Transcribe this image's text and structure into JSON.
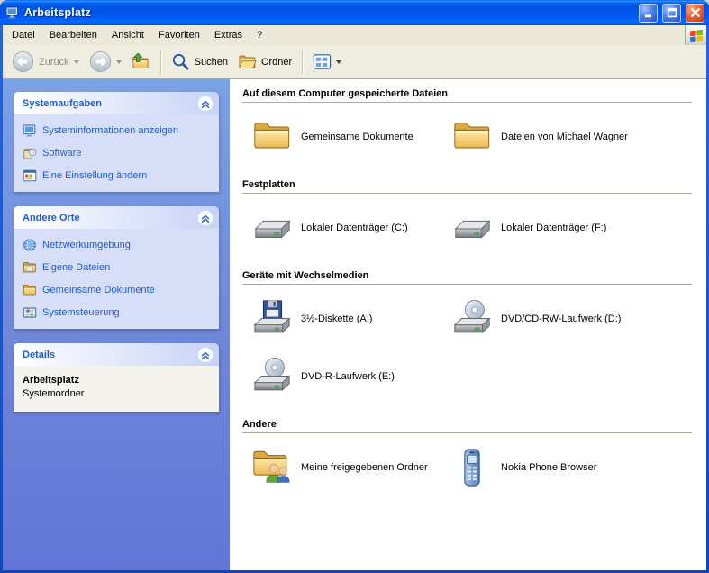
{
  "colors": {
    "titlebar_blue": "#0054E3",
    "taskpane_background": "#6E86D8",
    "taskpane_link": "#215DC6",
    "window_chrome": "#ECE9D8",
    "folder_yellow": "#EDB953",
    "close_button_red": "#C33B17"
  },
  "window": {
    "title": "Arbeitsplatz"
  },
  "menu": {
    "items": [
      "Datei",
      "Bearbeiten",
      "Ansicht",
      "Favoriten",
      "Extras",
      "?"
    ]
  },
  "toolbar": {
    "back": "Zurück",
    "search": "Suchen",
    "folders": "Ordner"
  },
  "sidebar": {
    "system_tasks": {
      "title": "Systemaufgaben",
      "items": [
        {
          "label": "Systeminformationen anzeigen",
          "icon": "system-information-icon"
        },
        {
          "label": "Software",
          "icon": "software-icon"
        },
        {
          "label": "Eine Einstellung ändern",
          "icon": "change-setting-icon"
        }
      ]
    },
    "other_places": {
      "title": "Andere Orte",
      "items": [
        {
          "label": "Netzwerkumgebung",
          "icon": "network-icon"
        },
        {
          "label": "Eigene Dateien",
          "icon": "my-documents-icon"
        },
        {
          "label": "Gemeinsame Dokumente",
          "icon": "shared-documents-icon"
        },
        {
          "label": "Systemsteuerung",
          "icon": "control-panel-icon"
        }
      ]
    },
    "details": {
      "title": "Details",
      "name": "Arbeitsplatz",
      "type": "Systemordner"
    }
  },
  "content": {
    "groups": [
      {
        "title": "Auf diesem Computer gespeicherte Dateien",
        "items": [
          {
            "label": "Gemeinsame Dokumente",
            "icon": "folder-icon"
          },
          {
            "label": "Dateien von Michael Wagner",
            "icon": "folder-icon"
          }
        ]
      },
      {
        "title": "Festplatten",
        "items": [
          {
            "label": "Lokaler Datenträger (C:)",
            "icon": "hard-drive-icon"
          },
          {
            "label": "Lokaler Datenträger (F:)",
            "icon": "hard-drive-icon"
          }
        ]
      },
      {
        "title": "Geräte mit Wechselmedien",
        "items": [
          {
            "label": "3½-Diskette (A:)",
            "icon": "floppy-drive-icon"
          },
          {
            "label": "DVD/CD-RW-Laufwerk (D:)",
            "icon": "cd-drive-icon"
          },
          {
            "label": "DVD-R-Laufwerk (E:)",
            "icon": "cd-drive-icon"
          }
        ]
      },
      {
        "title": "Andere",
        "items": [
          {
            "label": "Meine freigegebenen Ordner",
            "icon": "shared-folder-icon"
          },
          {
            "label": "Nokia Phone Browser",
            "icon": "phone-icon"
          }
        ]
      }
    ]
  }
}
